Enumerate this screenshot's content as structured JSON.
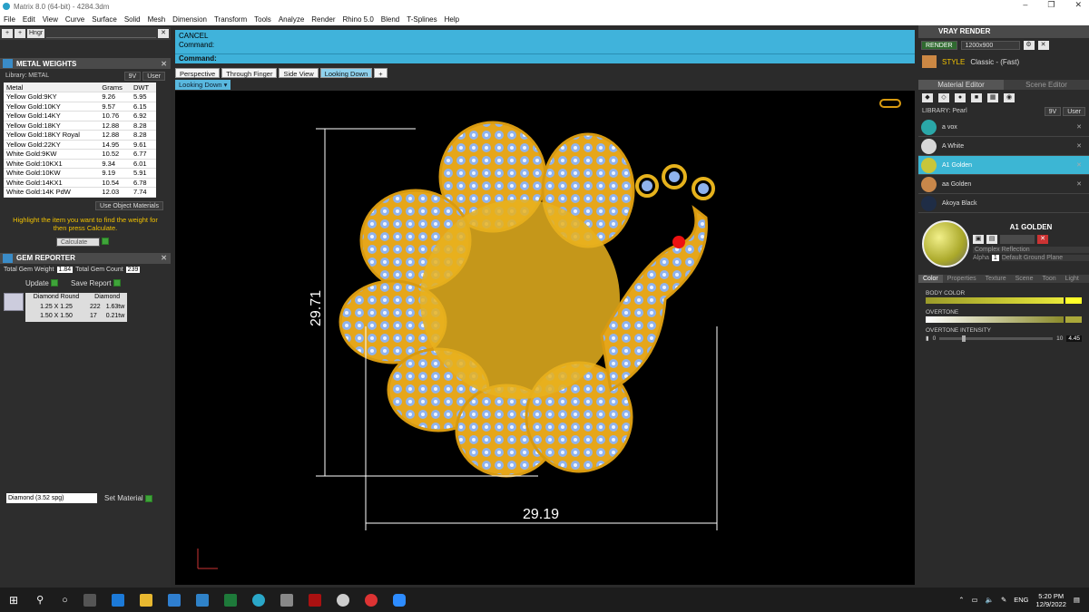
{
  "window": {
    "title": "Matrix 8.0 (64-bit) - 4284.3dm",
    "controls": [
      "–",
      "❐",
      "✕"
    ]
  },
  "menu": [
    "File",
    "Edit",
    "View",
    "Curve",
    "Surface",
    "Solid",
    "Mesh",
    "Dimension",
    "Transform",
    "Tools",
    "Analyze",
    "Render",
    "Rhino 5.0",
    "Blend",
    "T-Splines",
    "Help"
  ],
  "left": {
    "toolbar_btn": "Hngr",
    "metal_panel_title": "METAL WEIGHTS",
    "library_label": "Library: METAL",
    "library_tabs": [
      "9V",
      "User"
    ],
    "columns": [
      "Metal",
      "Grams",
      "DWT"
    ],
    "rows": [
      [
        "Yellow Gold:9KY",
        "9.26",
        "5.95"
      ],
      [
        "Yellow Gold:10KY",
        "9.57",
        "6.15"
      ],
      [
        "Yellow Gold:14KY",
        "10.76",
        "6.92"
      ],
      [
        "Yellow Gold:18KY",
        "12.88",
        "8.28"
      ],
      [
        "Yellow Gold:18KY Royal",
        "12.88",
        "8.28"
      ],
      [
        "Yellow Gold:22KY",
        "14.95",
        "9.61"
      ],
      [
        "White Gold:9KW",
        "10.52",
        "6.77"
      ],
      [
        "White Gold:10KX1",
        "9.34",
        "6.01"
      ],
      [
        "White Gold:10KW",
        "9.19",
        "5.91"
      ],
      [
        "White Gold:14KX1",
        "10.54",
        "6.78"
      ],
      [
        "White Gold:14K PdW",
        "12.03",
        "7.74"
      ]
    ],
    "use_object_materials": "Use Object Materials",
    "instruction": "Highlight the item you want to find the weight for then press Calculate.",
    "calculate": "Calculate",
    "gem_panel_title": "GEM REPORTER",
    "total_gem_weight_label": "Total Gem Weight",
    "total_gem_weight": "1.84",
    "total_gem_count_label": "Total Gem Count",
    "total_gem_count": "239",
    "update": "Update",
    "save_report": "Save Report",
    "gem_columns": [
      "Diamond Round",
      "Diamond"
    ],
    "gem_rows": [
      [
        "1.25 X 1.25",
        "222",
        "1.63tw"
      ],
      [
        "1.50 X 1.50",
        "17",
        "0.21tw"
      ]
    ],
    "material_select": "Diamond   (3.52 spg)",
    "set_material": "Set Material"
  },
  "center": {
    "cancel": "CANCEL",
    "command1": "Command:",
    "command_prompt": "Command:",
    "tabs": [
      "Perspective",
      "Through Finger",
      "Side View",
      "Looking Down"
    ],
    "active_tab": "Looking Down",
    "viewport_label": "Looking Down",
    "dimension_height": "29.71",
    "dimension_width": "29.19"
  },
  "right": {
    "title": "VRAY RENDER",
    "render_btn": "RENDER",
    "resolution": "1200x900",
    "style_label": "STYLE",
    "style_value": "Classic - (Fast)",
    "tabs": [
      "Material Editor",
      "Scene Editor"
    ],
    "library_label": "LIBRARY: Pearl",
    "library_tabs": [
      "9V",
      "User"
    ],
    "materials": [
      {
        "name": "a vox",
        "color": "#2aa7a8"
      },
      {
        "name": "A White",
        "color": "#d8d8d8"
      },
      {
        "name": "A1 Golden",
        "color": "#c8c63a"
      },
      {
        "name": "aa Golden",
        "color": "#c8874a"
      },
      {
        "name": "Akoya Black",
        "color": "#1f2d46"
      }
    ],
    "selected_material": "A1 GOLDEN",
    "complex_reflection": "Complex Reflection",
    "alpha_label": "Alpha",
    "alpha_value": "1",
    "ground_plane": "Default Ground Plane",
    "prop_tabs": [
      "Color",
      "Properties",
      "Texture",
      "Scene",
      "Toon",
      "Light"
    ],
    "body_color": "BODY COLOR",
    "overtone": "OVERTONE",
    "overtone_intensity": "OVERTONE INTENSITY",
    "intensity_min": "0",
    "intensity_max": "10",
    "intensity_value": "4.45"
  },
  "taskbar": {
    "lang": "ENG",
    "time": "5:20 PM",
    "date": "12/9/2022"
  }
}
